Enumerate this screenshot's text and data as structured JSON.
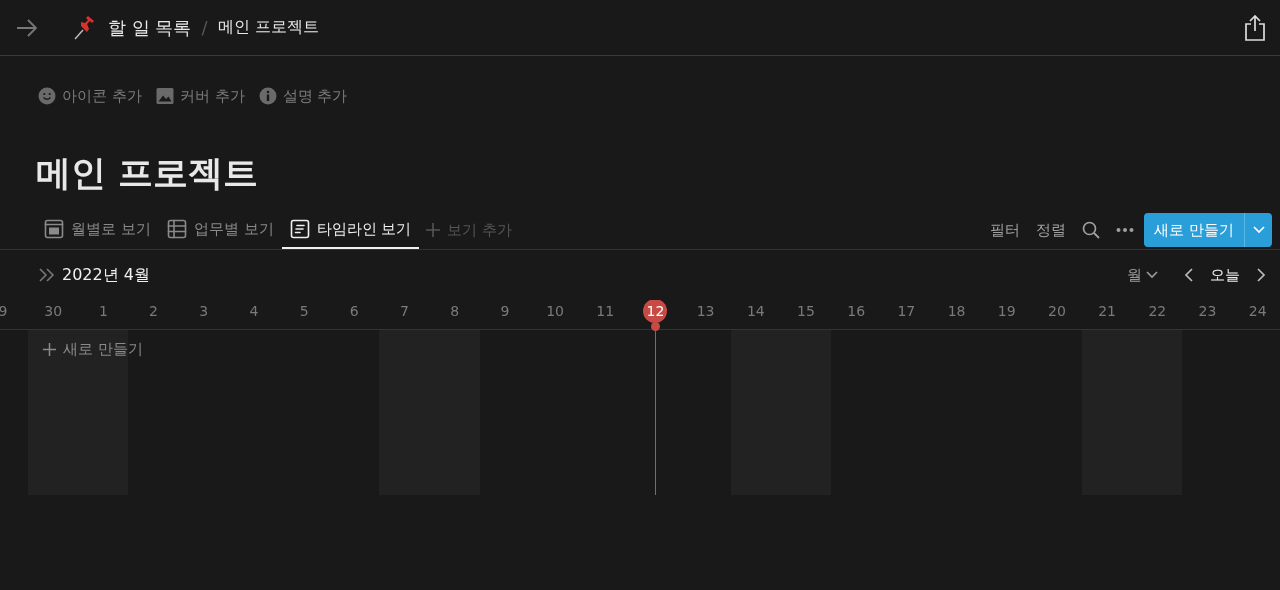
{
  "breadcrumb": {
    "parent": "할 일 목록",
    "separator": "/",
    "current": "메인 프로젝트"
  },
  "page_actions": [
    "아이콘 추가",
    "커버 추가",
    "설명 추가"
  ],
  "title": "메인 프로젝트",
  "views": [
    {
      "kind": "calendar",
      "label": "월별로 보기",
      "selected": false
    },
    {
      "kind": "table",
      "label": "업무별 보기",
      "selected": false
    },
    {
      "kind": "timeline",
      "label": "타임라인 보기",
      "selected": true
    }
  ],
  "add_view": "보기 추가",
  "toolbar": {
    "filter": "필터",
    "sort": "정렬",
    "new_button": "새로 만들기"
  },
  "timeline": {
    "month": "2022년 4월",
    "scale": "월",
    "today": "오늘",
    "new_item": "새로 만들기",
    "days": [
      {
        "label": "9",
        "weekend": false,
        "selected": false
      },
      {
        "label": "30",
        "weekend": true,
        "selected": false
      },
      {
        "label": "1",
        "weekend": true,
        "selected": false
      },
      {
        "label": "2",
        "weekend": false,
        "selected": false
      },
      {
        "label": "3",
        "weekend": false,
        "selected": false
      },
      {
        "label": "4",
        "weekend": false,
        "selected": false
      },
      {
        "label": "5",
        "weekend": false,
        "selected": false
      },
      {
        "label": "6",
        "weekend": false,
        "selected": false
      },
      {
        "label": "7",
        "weekend": true,
        "selected": false
      },
      {
        "label": "8",
        "weekend": true,
        "selected": false
      },
      {
        "label": "9",
        "weekend": false,
        "selected": false
      },
      {
        "label": "10",
        "weekend": false,
        "selected": false
      },
      {
        "label": "11",
        "weekend": false,
        "selected": false
      },
      {
        "label": "12",
        "weekend": false,
        "selected": true
      },
      {
        "label": "13",
        "weekend": false,
        "selected": false
      },
      {
        "label": "14",
        "weekend": true,
        "selected": false
      },
      {
        "label": "15",
        "weekend": true,
        "selected": false
      },
      {
        "label": "16",
        "weekend": false,
        "selected": false
      },
      {
        "label": "17",
        "weekend": false,
        "selected": false
      },
      {
        "label": "18",
        "weekend": false,
        "selected": false
      },
      {
        "label": "19",
        "weekend": false,
        "selected": false
      },
      {
        "label": "20",
        "weekend": false,
        "selected": false
      },
      {
        "label": "21",
        "weekend": true,
        "selected": false
      },
      {
        "label": "22",
        "weekend": true,
        "selected": false
      },
      {
        "label": "23",
        "weekend": false,
        "selected": false
      },
      {
        "label": "24",
        "weekend": false,
        "selected": false
      }
    ]
  }
}
